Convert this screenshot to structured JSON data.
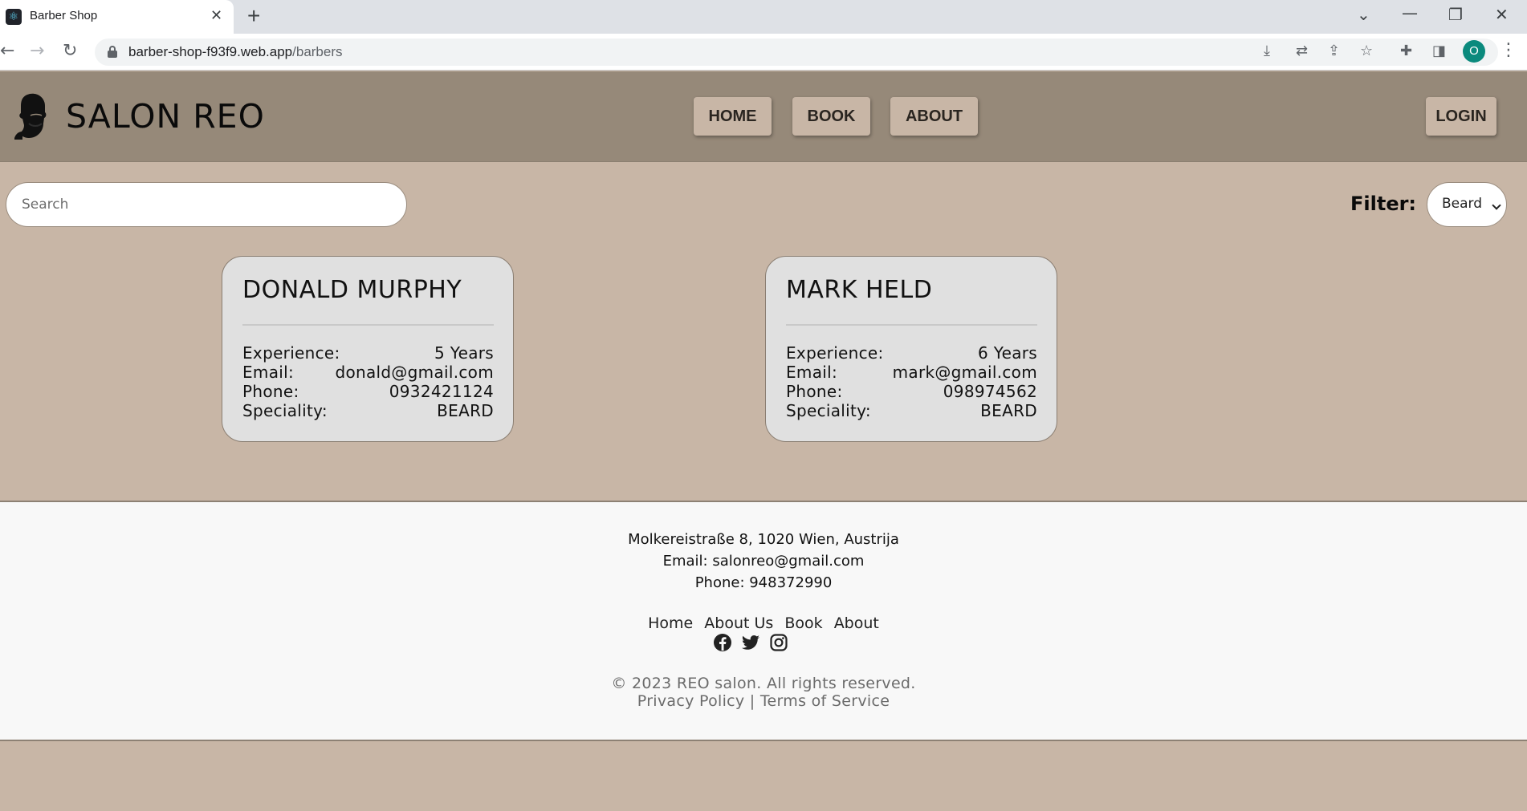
{
  "browser": {
    "tab_title": "Barber Shop",
    "tab_close": "✕",
    "new_tab": "+",
    "url_host": "barber-shop-f93f9.web.app",
    "url_path": "/barbers",
    "profile_initial": "O",
    "icons": [
      "back-icon",
      "forward-icon",
      "reload-icon",
      "lock-icon",
      "install-icon",
      "translate-icon",
      "share-icon",
      "star-icon",
      "extensions-icon",
      "side-panel-icon",
      "menu-icon"
    ]
  },
  "header": {
    "brand": "SALON REO",
    "nav": {
      "home": "HOME",
      "book": "BOOK",
      "about": "ABOUT"
    },
    "login": "LOGIN",
    "button_color": "#c8b6a6",
    "background": "#968979"
  },
  "toolbar": {
    "search_placeholder": "Search",
    "filter_label": "Filter:",
    "filter_value": "Beard"
  },
  "barbers": [
    {
      "name": "DONALD MURPHY",
      "rows": [
        {
          "label": "Experience:",
          "value": "5 Years"
        },
        {
          "label": "Email:",
          "value": "donald@gmail.com"
        },
        {
          "label": "Phone:",
          "value": "0932421124"
        },
        {
          "label": "Speciality:",
          "value": "BEARD"
        }
      ]
    },
    {
      "name": "MARK HELD",
      "rows": [
        {
          "label": "Experience:",
          "value": "6 Years"
        },
        {
          "label": "Email:",
          "value": "mark@gmail.com"
        },
        {
          "label": "Phone:",
          "value": "098974562"
        },
        {
          "label": "Speciality:",
          "value": "BEARD"
        }
      ]
    }
  ],
  "footer": {
    "address": "Molkereistraße 8, 1020 Wien, Austrija",
    "email": "Email: salonreo@gmail.com",
    "phone": "Phone: 948372990",
    "links": {
      "home": "Home",
      "about_us": "About Us",
      "book": "Book",
      "about": "About"
    },
    "socials": [
      "facebook-icon",
      "twitter-icon",
      "instagram-icon"
    ],
    "copyright": "© 2023 REO salon. All rights reserved.",
    "privacy": "Privacy Policy",
    "separator": "|",
    "terms": "Terms of Service"
  },
  "colors": {
    "page_background": "#c8b6a6",
    "card_background": "#e0e0e0",
    "footer_background": "#f8f8f8"
  }
}
